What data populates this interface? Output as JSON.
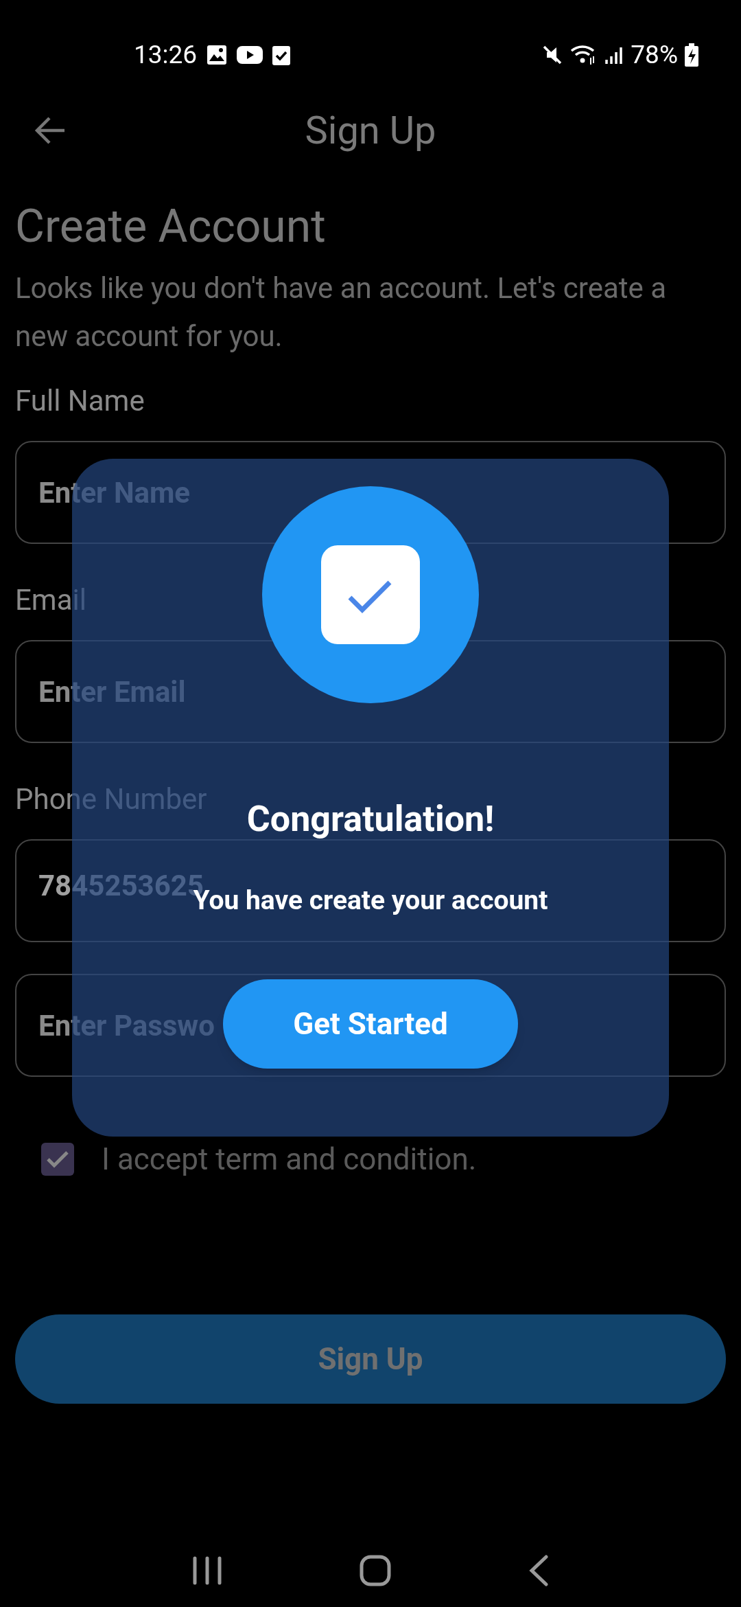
{
  "status_bar": {
    "time": "13:26",
    "battery": "78%"
  },
  "app_bar": {
    "title": "Sign Up"
  },
  "heading": "Create Account",
  "subtitle": "Looks like you don't have an account. Let's create a new account for you.",
  "fields": [
    {
      "label": "Full Name",
      "placeholder": "Enter Name"
    },
    {
      "label": "Email",
      "placeholder": "Enter Email"
    },
    {
      "label": "Phone Number",
      "value": "7845253625"
    },
    {
      "placeholder": "Enter Passwo"
    }
  ],
  "terms": {
    "label": "I accept term and condition.",
    "checked": true
  },
  "submit": "Sign Up",
  "dialog": {
    "title": "Congratulation!",
    "message": "You have create your account",
    "button": "Get Started"
  }
}
